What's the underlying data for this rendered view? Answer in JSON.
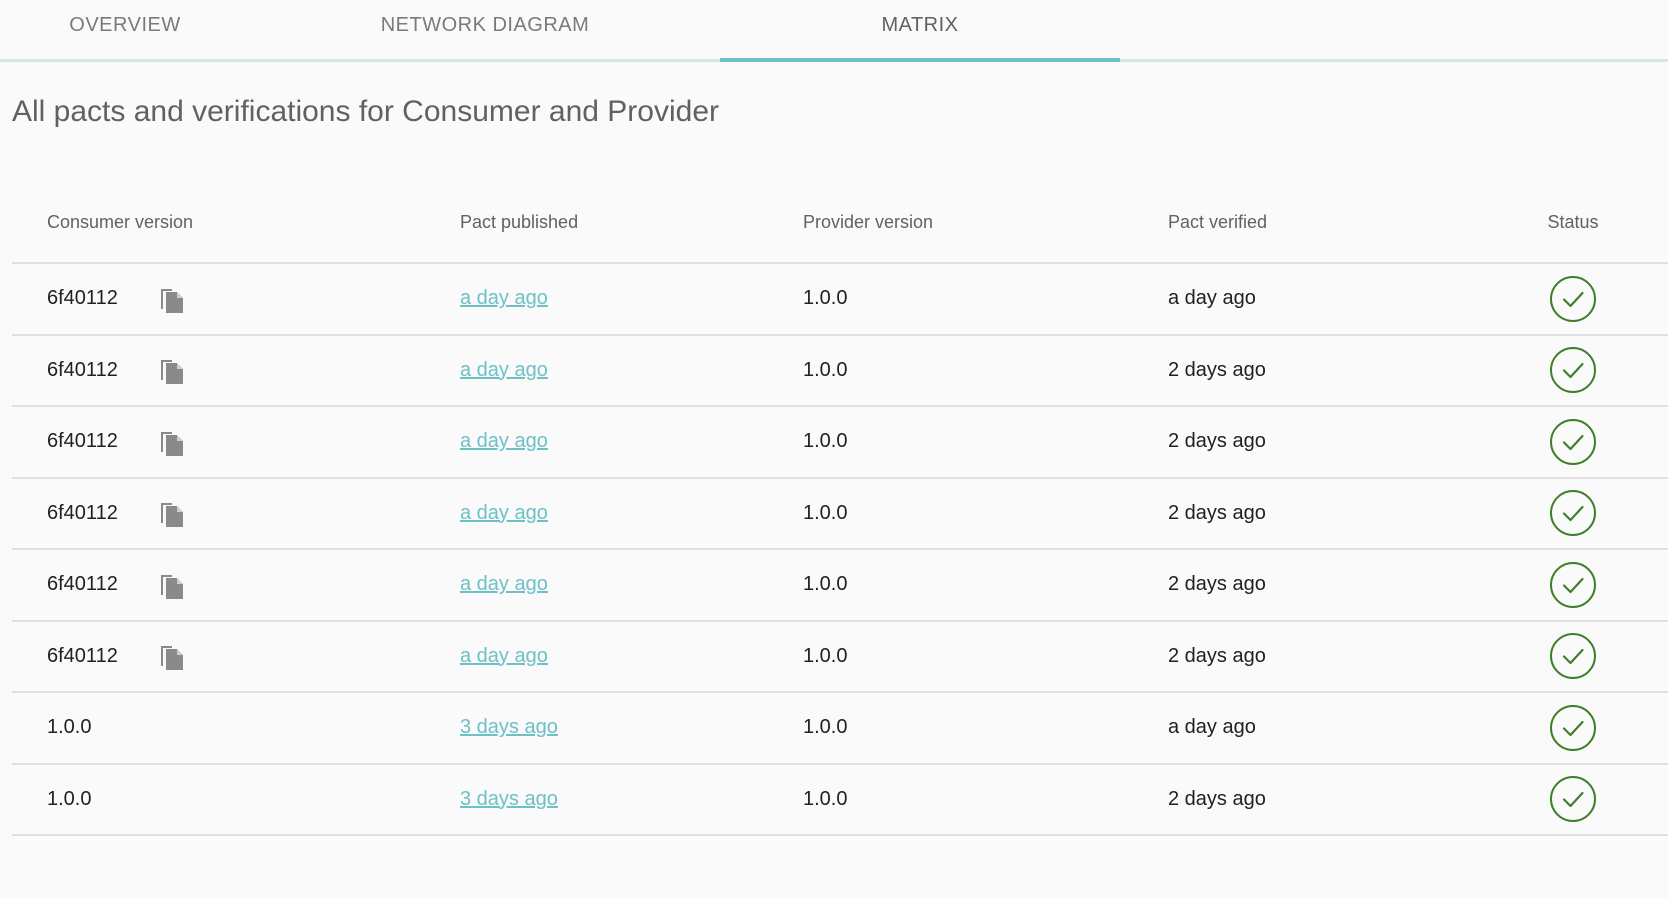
{
  "tabs": [
    {
      "label": "OVERVIEW",
      "active": false
    },
    {
      "label": "NETWORK DIAGRAM",
      "active": false
    },
    {
      "label": "MATRIX",
      "active": true
    }
  ],
  "page_title": "All pacts and verifications for Consumer and Provider",
  "table": {
    "headers": {
      "consumer_version": "Consumer version",
      "pact_published": "Pact published",
      "provider_version": "Provider version",
      "pact_verified": "Pact verified",
      "status": "Status"
    },
    "rows": [
      {
        "consumer_version": "6f40112",
        "has_copy": true,
        "pact_published": "a day ago",
        "provider_version": "1.0.0",
        "pact_verified": "a day ago",
        "status": "success"
      },
      {
        "consumer_version": "6f40112",
        "has_copy": true,
        "pact_published": "a day ago",
        "provider_version": "1.0.0",
        "pact_verified": "2 days ago",
        "status": "success"
      },
      {
        "consumer_version": "6f40112",
        "has_copy": true,
        "pact_published": "a day ago",
        "provider_version": "1.0.0",
        "pact_verified": "2 days ago",
        "status": "success"
      },
      {
        "consumer_version": "6f40112",
        "has_copy": true,
        "pact_published": "a day ago",
        "provider_version": "1.0.0",
        "pact_verified": "2 days ago",
        "status": "success"
      },
      {
        "consumer_version": "6f40112",
        "has_copy": true,
        "pact_published": "a day ago",
        "provider_version": "1.0.0",
        "pact_verified": "2 days ago",
        "status": "success"
      },
      {
        "consumer_version": "6f40112",
        "has_copy": true,
        "pact_published": "a day ago",
        "provider_version": "1.0.0",
        "pact_verified": "2 days ago",
        "status": "success"
      },
      {
        "consumer_version": "1.0.0",
        "has_copy": false,
        "pact_published": "3 days ago",
        "provider_version": "1.0.0",
        "pact_verified": "a day ago",
        "status": "success"
      },
      {
        "consumer_version": "1.0.0",
        "has_copy": false,
        "pact_published": "3 days ago",
        "provider_version": "1.0.0",
        "pact_verified": "2 days ago",
        "status": "success"
      }
    ]
  },
  "icons": {
    "copy": "copy-icon",
    "status_success": "check-circle-icon"
  },
  "colors": {
    "accent": "#6cc1c7",
    "tab_underline": "#cfe9ea",
    "success": "#3f7f2a",
    "icon_gray": "#8a8a8a",
    "divider": "#e0e0e0"
  }
}
